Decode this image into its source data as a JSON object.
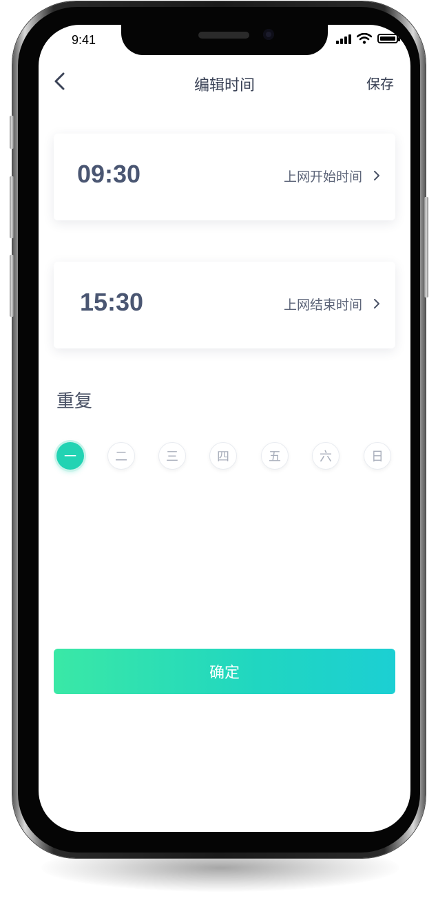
{
  "status_bar": {
    "time": "9:41"
  },
  "nav": {
    "title": "编辑时间",
    "save_label": "保存"
  },
  "start_card": {
    "time": "09:30",
    "label": "上网开始时间"
  },
  "end_card": {
    "time": "15:30",
    "label": "上网结束时间"
  },
  "repeat": {
    "label": "重复",
    "days": [
      {
        "label": "一",
        "selected": true
      },
      {
        "label": "二",
        "selected": false
      },
      {
        "label": "三",
        "selected": false
      },
      {
        "label": "四",
        "selected": false
      },
      {
        "label": "五",
        "selected": false
      },
      {
        "label": "六",
        "selected": false
      },
      {
        "label": "日",
        "selected": false
      }
    ]
  },
  "confirm_label": "确定",
  "colors": {
    "accent": "#22d3b3",
    "gradient_start": "#3ae8a6",
    "gradient_end": "#1ccfd3",
    "text_primary": "#3a4256"
  }
}
